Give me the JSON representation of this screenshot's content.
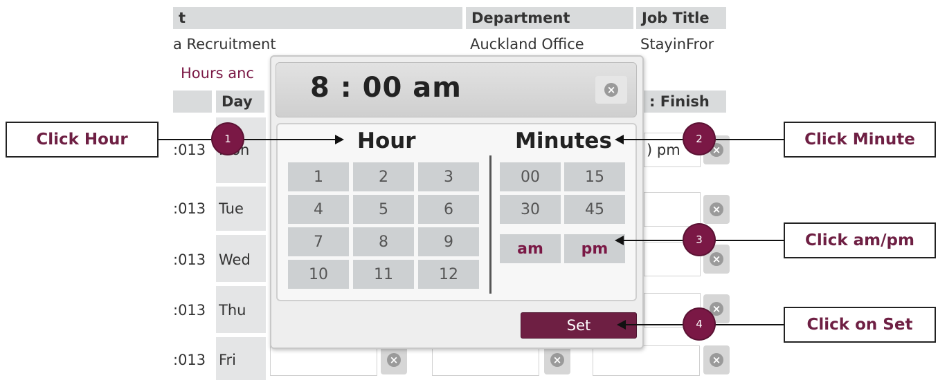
{
  "table": {
    "headers": {
      "first": "t",
      "department": "Department",
      "job_title": "Job Title",
      "day": "Day",
      "finish": ": Finish"
    },
    "info_row": {
      "name_fragment": "a Recruitment",
      "department": "Auckland Office",
      "job_title": "StayinFror"
    },
    "section_fragment": "Hours anc",
    "rows": [
      {
        "date": ":013",
        "day": "Mon",
        "finish_value": ") pm"
      },
      {
        "date": ":013",
        "day": "Tue"
      },
      {
        "date": ":013",
        "day": "Wed"
      },
      {
        "date": ":013",
        "day": "Thu"
      },
      {
        "date": ":013",
        "day": "Fri"
      }
    ]
  },
  "picker": {
    "time_display": "8 : 00 am",
    "hour_label": "Hour",
    "minutes_label": "Minutes",
    "hours": [
      "1",
      "2",
      "3",
      "4",
      "5",
      "6",
      "7",
      "8",
      "9",
      "10",
      "11",
      "12"
    ],
    "minutes": [
      "00",
      "15",
      "30",
      "45"
    ],
    "am_label": "am",
    "pm_label": "pm",
    "set_label": "Set"
  },
  "callouts": {
    "hour": "Click Hour",
    "minute": "Click Minute",
    "ampm": "Click am/pm",
    "set": "Click on Set"
  },
  "badges": [
    "1",
    "2",
    "3",
    "4"
  ],
  "colors": {
    "accent": "#6e1f43",
    "badge": "#7a1845",
    "header_bg": "#d9dbdc"
  },
  "icons": {
    "clear": "clear-x-icon"
  }
}
